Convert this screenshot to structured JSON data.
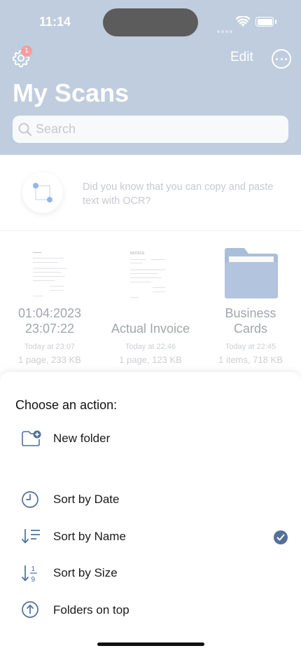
{
  "status_bar": {
    "time": "11:14"
  },
  "header": {
    "settings_badge": "1",
    "edit_label": "Edit",
    "title": "My Scans",
    "search_placeholder": "Search"
  },
  "tip": {
    "text": "Did you know that you can copy and paste text with OCR?"
  },
  "files": [
    {
      "name_line1": "01:04:2023",
      "name_line2": "23:07:22",
      "date": "Today at 23:07",
      "info": "1 page, 233 KB"
    },
    {
      "name_line1": "Actual Invoice",
      "name_line2": "",
      "date": "Today at 22:46",
      "info": "1 page, 123 KB"
    },
    {
      "name_line1": "Business",
      "name_line2": "Cards",
      "date": "Today at 22:45",
      "info": "1 items, 718 KB"
    }
  ],
  "thumb_label": "INVOICE",
  "action_sheet": {
    "title": "Choose an action:",
    "items": [
      {
        "label": "New folder",
        "icon": "folder-plus-icon"
      },
      {
        "label": "Sort by Date",
        "icon": "clock-icon"
      },
      {
        "label": "Sort by Name",
        "icon": "sort-name-icon",
        "selected": true
      },
      {
        "label": "Sort by Size",
        "icon": "sort-size-icon"
      },
      {
        "label": "Folders on top",
        "icon": "arrow-up-circle-icon"
      }
    ]
  },
  "colors": {
    "header": "#9db2cd",
    "accent": "#54709a",
    "icon": "#4d6f9a"
  }
}
